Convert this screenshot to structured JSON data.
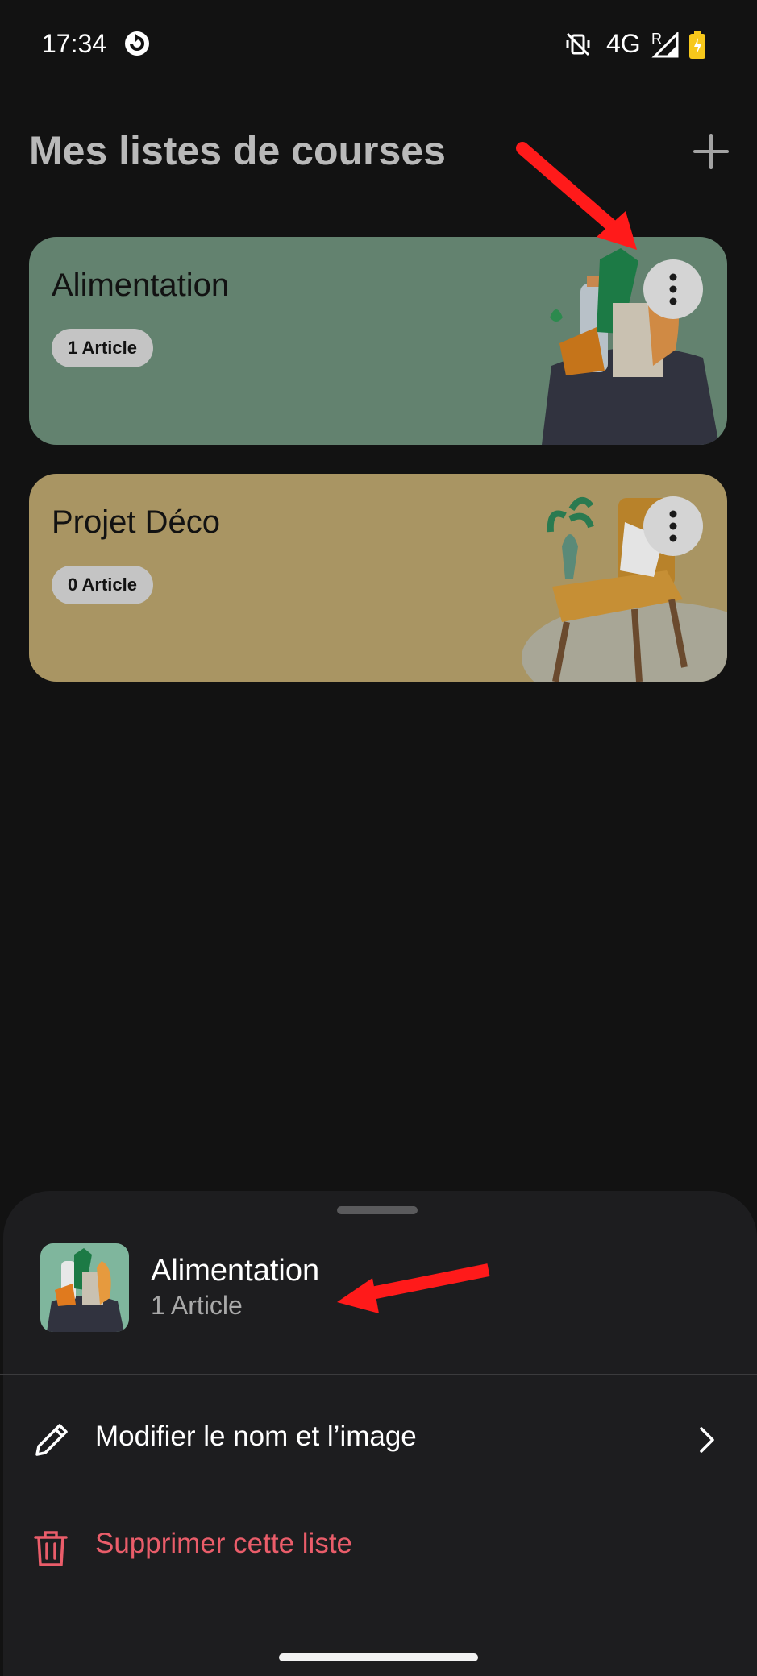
{
  "status_bar": {
    "time": "17:34",
    "network": "4G",
    "roaming": "R"
  },
  "header": {
    "title": "Mes listes de courses"
  },
  "lists": [
    {
      "title": "Alimentation",
      "count": "1 Article",
      "color": "#63826f"
    },
    {
      "title": "Projet Déco",
      "count": "0 Article",
      "color": "#a99563"
    }
  ],
  "sheet": {
    "title": "Alimentation",
    "subtitle": "1 Article",
    "edit_label": "Modifier le nom et l’image",
    "delete_label": "Supprimer cette liste"
  },
  "colors": {
    "delete": "#ea5d6a",
    "annotation": "#ff1a1a"
  }
}
